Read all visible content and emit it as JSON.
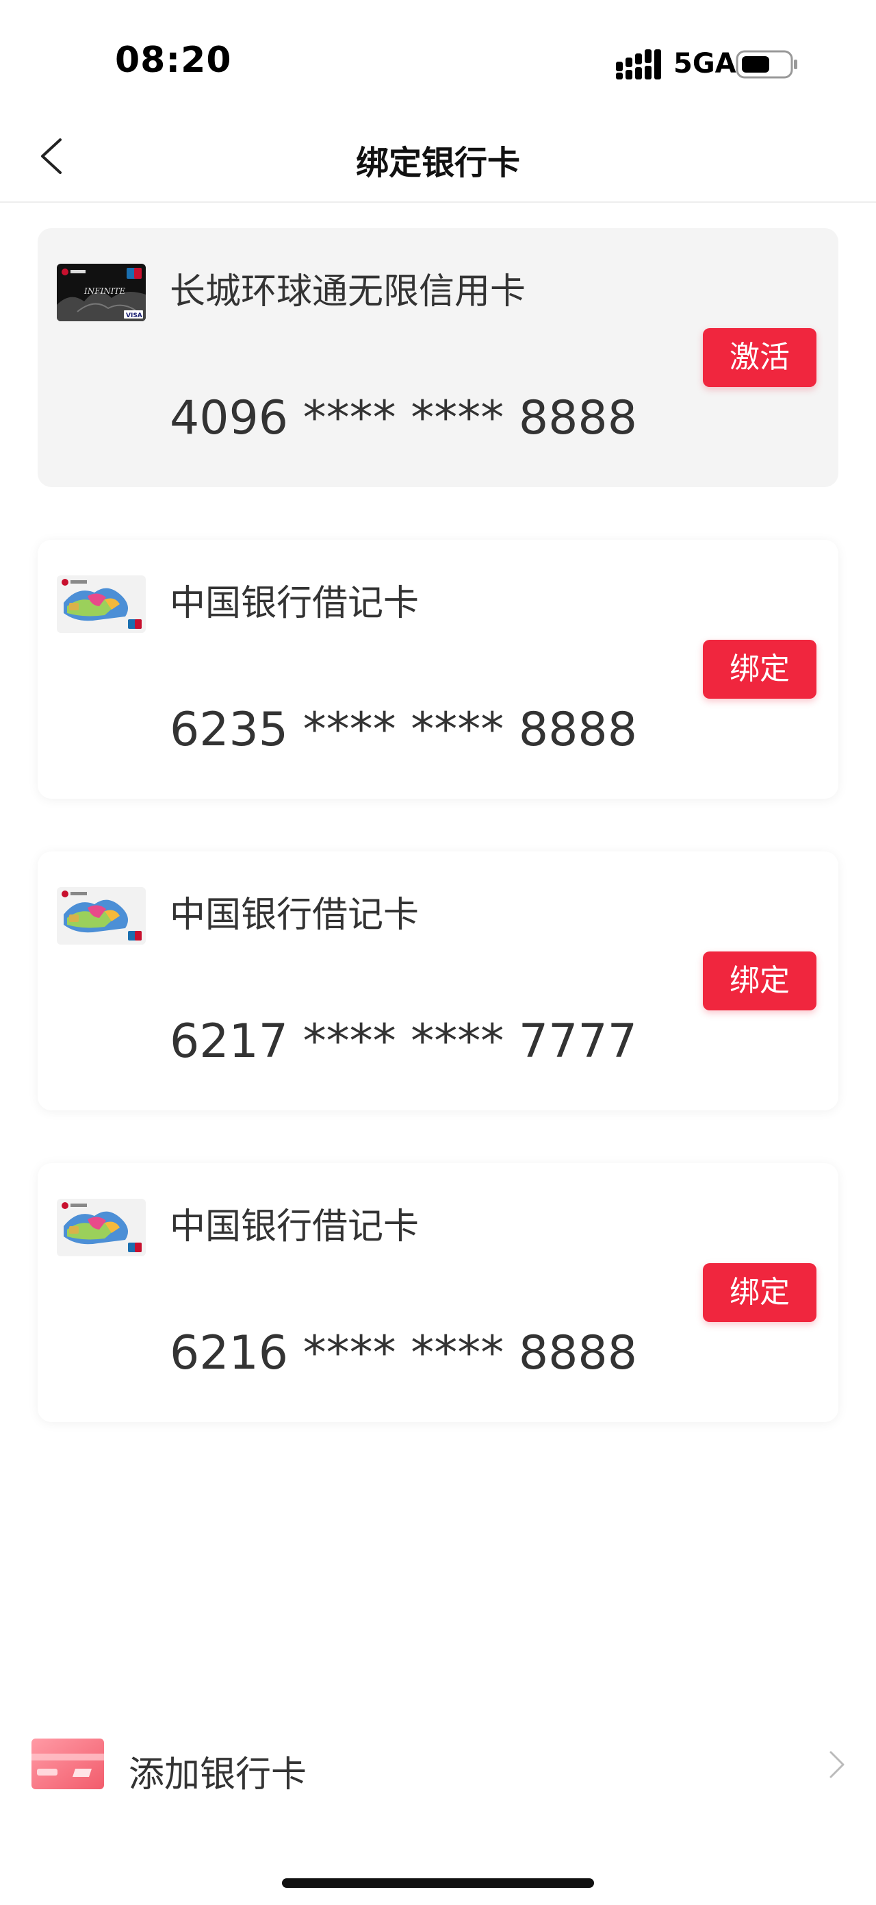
{
  "status_bar": {
    "time": "08:20",
    "network": "5GA",
    "icons": [
      "signal-icon",
      "battery-icon"
    ]
  },
  "nav": {
    "title": "绑定银行卡",
    "back_icon": "chevron-left-icon"
  },
  "cards": [
    {
      "name": "长城环球通无限信用卡",
      "number": "4096 **** **** 8888",
      "button": "激活",
      "thumbnail": "credit-card-black-icon"
    },
    {
      "name": "中国银行借记卡",
      "number": "6235 **** **** 8888",
      "button": "绑定",
      "thumbnail": "debit-card-icon"
    },
    {
      "name": "中国银行借记卡",
      "number": "6217 **** **** 7777",
      "button": "绑定",
      "thumbnail": "debit-card-icon"
    },
    {
      "name": "中国银行借记卡",
      "number": "6216 **** **** 8888",
      "button": "绑定",
      "thumbnail": "debit-card-icon"
    }
  ],
  "add_card": {
    "label": "添加银行卡",
    "icon": "add-card-icon",
    "arrow": "chevron-right-icon"
  },
  "colors": {
    "accent": "#f0263e",
    "card_highlight_bg": "#f4f4f4",
    "text": "#333333"
  }
}
